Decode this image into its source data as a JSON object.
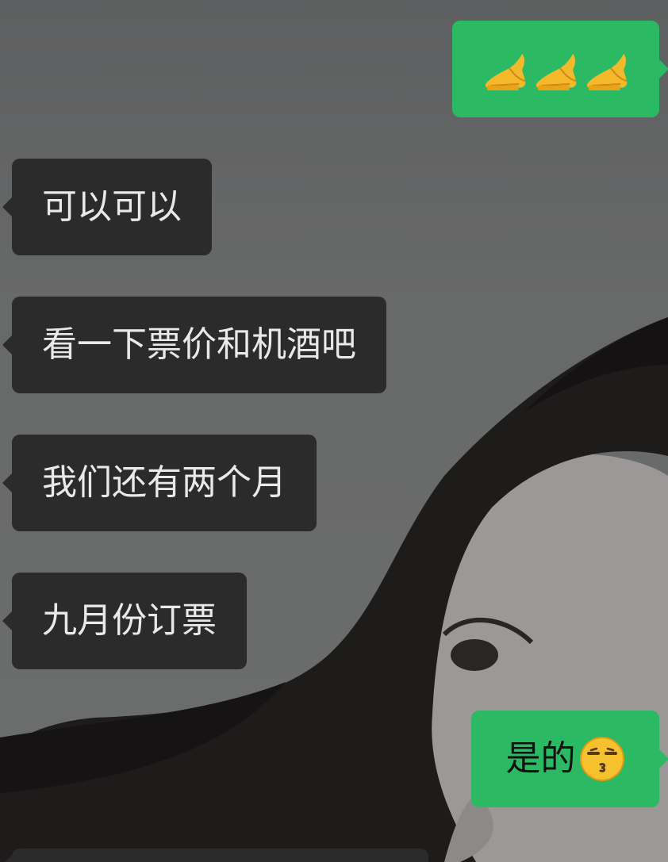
{
  "messages": [
    {
      "direction": "outgoing",
      "emoji": [
        "pray-hands-icon",
        "pray-hands-icon",
        "pray-hands-icon"
      ]
    },
    {
      "direction": "incoming",
      "text": "可以可以"
    },
    {
      "direction": "incoming",
      "text": "看一下票价和机酒吧"
    },
    {
      "direction": "incoming",
      "text": "我们还有两个月"
    },
    {
      "direction": "incoming",
      "text": "九月份订票"
    },
    {
      "direction": "outgoing",
      "text": "是的",
      "emoji": "kissing-face-icon"
    }
  ],
  "colors": {
    "outgoing_bubble": "#2bb963",
    "incoming_bubble": "#2b2b2b",
    "incoming_text": "#e9e9e9",
    "outgoing_text": "#111111"
  }
}
